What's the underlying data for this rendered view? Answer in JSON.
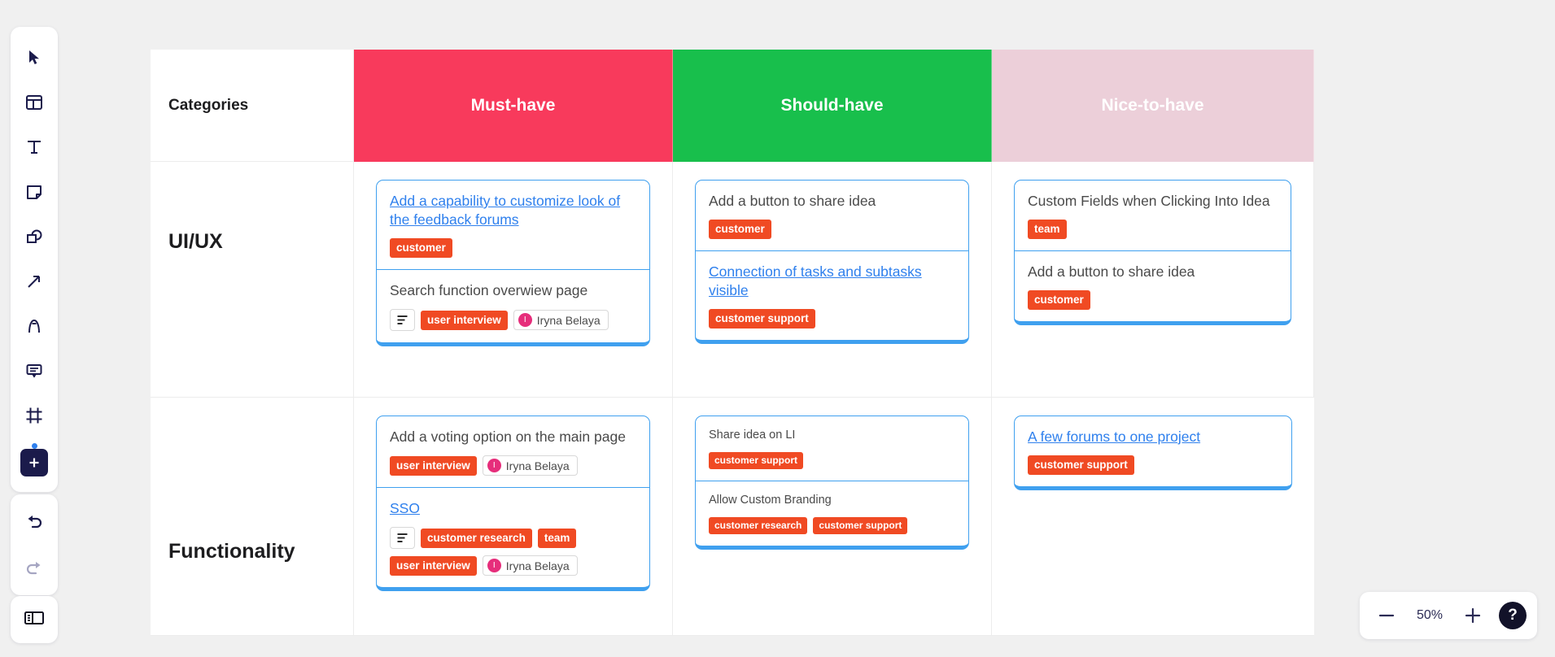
{
  "toolbar": {
    "tools": [
      {
        "name": "select-cursor-tool",
        "icon": "cursor-icon"
      },
      {
        "name": "frame-layout-tool",
        "icon": "layout-icon"
      },
      {
        "name": "text-tool",
        "icon": "text-t-icon"
      },
      {
        "name": "sticky-note-tool",
        "icon": "sticky-note-icon"
      },
      {
        "name": "shapes-tool",
        "icon": "shapes-icon"
      },
      {
        "name": "arrow-connector-tool",
        "icon": "arrow-icon"
      },
      {
        "name": "pen-draw-tool",
        "icon": "pen-icon"
      },
      {
        "name": "comment-tool",
        "icon": "comment-icon"
      },
      {
        "name": "frame-tool",
        "icon": "frame-icon"
      },
      {
        "name": "add-more-tool",
        "icon": "plus-box-icon"
      }
    ],
    "undo": {
      "name": "undo-button",
      "icon": "undo-icon"
    },
    "redo": {
      "name": "redo-button",
      "icon": "redo-icon"
    },
    "panel": {
      "name": "toggle-panel-button",
      "icon": "panel-toggle-icon"
    }
  },
  "matrix": {
    "columns": [
      {
        "label": "Categories",
        "color": "#ffffff"
      },
      {
        "label": "Must-have",
        "color": "#f83a5c"
      },
      {
        "label": "Should-have",
        "color": "#18bf4c"
      },
      {
        "label": "Nice-to-have",
        "color": "#eccfd9"
      }
    ],
    "rows": [
      {
        "label": "UI/UX",
        "cells": [
          {
            "column": "Must-have",
            "cards": [
              {
                "title": "Add a capability to customize look of the feedback forums",
                "is_link": true,
                "chip_rows": [
                  [
                    {
                      "type": "tag",
                      "label": "customer"
                    }
                  ]
                ]
              },
              {
                "title": "Search function overwiew page",
                "is_link": false,
                "chip_rows": [
                  [
                    {
                      "type": "desc",
                      "label": ""
                    },
                    {
                      "type": "tag",
                      "label": "user interview"
                    },
                    {
                      "type": "person",
                      "label": "Iryna Belaya",
                      "initial": "I"
                    }
                  ]
                ]
              }
            ]
          },
          {
            "column": "Should-have",
            "cards": [
              {
                "title": "Add a button to share idea",
                "is_link": false,
                "chip_rows": [
                  [
                    {
                      "type": "tag",
                      "label": "customer"
                    }
                  ]
                ]
              },
              {
                "title": "Connection of tasks and subtasks visible",
                "is_link": true,
                "chip_rows": [
                  [
                    {
                      "type": "tag",
                      "label": "customer support"
                    }
                  ]
                ]
              }
            ]
          },
          {
            "column": "Nice-to-have",
            "cards": [
              {
                "title": "Custom Fields when Clicking Into Idea",
                "is_link": false,
                "chip_rows": [
                  [
                    {
                      "type": "tag",
                      "label": "team"
                    }
                  ]
                ]
              },
              {
                "title": "Add a button to share idea",
                "is_link": false,
                "chip_rows": [
                  [
                    {
                      "type": "tag",
                      "label": "customer"
                    }
                  ]
                ]
              }
            ]
          }
        ]
      },
      {
        "label": "Functionality",
        "cells": [
          {
            "column": "Must-have",
            "cards": [
              {
                "title": "Add a voting option on the main page",
                "is_link": false,
                "chip_rows": [
                  [
                    {
                      "type": "tag",
                      "label": "user interview"
                    },
                    {
                      "type": "person",
                      "label": "Iryna Belaya",
                      "initial": "I"
                    }
                  ]
                ]
              },
              {
                "title": "SSO",
                "is_link": true,
                "chip_rows": [
                  [
                    {
                      "type": "desc",
                      "label": ""
                    },
                    {
                      "type": "tag",
                      "label": "customer research"
                    },
                    {
                      "type": "tag",
                      "label": "team"
                    }
                  ],
                  [
                    {
                      "type": "tag",
                      "label": "user interview"
                    },
                    {
                      "type": "person",
                      "label": "Iryna Belaya",
                      "initial": "I"
                    }
                  ]
                ]
              }
            ]
          },
          {
            "column": "Should-have",
            "cards": [
              {
                "title": "Share idea on LI",
                "is_link": false,
                "small": true,
                "chip_rows": [
                  [
                    {
                      "type": "tag",
                      "label": "customer support",
                      "small": true
                    }
                  ]
                ]
              },
              {
                "title": "Allow Custom Branding",
                "is_link": false,
                "small": true,
                "chip_rows": [
                  [
                    {
                      "type": "tag",
                      "label": "customer research",
                      "small": true
                    },
                    {
                      "type": "tag",
                      "label": "customer support",
                      "small": true
                    }
                  ]
                ]
              }
            ]
          },
          {
            "column": "Nice-to-have",
            "cards": [
              {
                "title": "A few forums to one project",
                "is_link": true,
                "chip_rows": [
                  [
                    {
                      "type": "tag",
                      "label": "customer support"
                    }
                  ]
                ]
              }
            ]
          }
        ]
      }
    ]
  },
  "zoom_controls": {
    "zoom_out_label": "−",
    "zoom_level": "50%",
    "zoom_in_label": "+",
    "help_label": "?"
  },
  "colors": {
    "must_have": "#f83a5c",
    "should_have": "#18bf4c",
    "nice_to_have": "#eccfd9",
    "tag": "#f04a23",
    "card_border": "#3fa0ef",
    "link": "#2f80ed",
    "avatar": "#e62e7b"
  }
}
